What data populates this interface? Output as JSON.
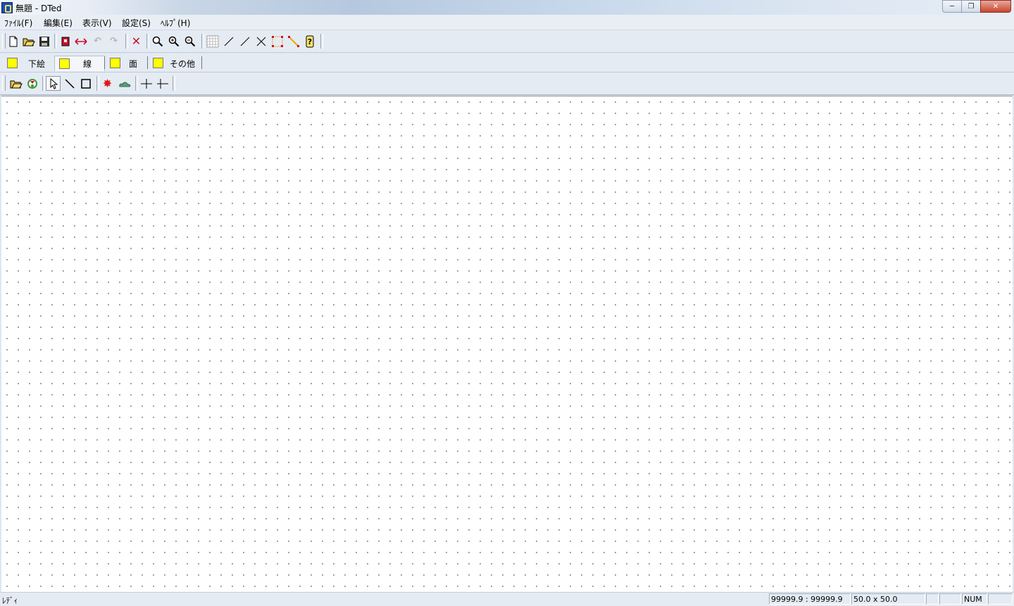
{
  "window": {
    "title": "無題 - DTed",
    "controls": [
      "minimize",
      "maximize",
      "close"
    ]
  },
  "menu": [
    "ﾌｧｲﾙ(F)",
    "編集(E)",
    "表示(V)",
    "設定(S)",
    "ﾍﾙﾌﾟ(H)"
  ],
  "toolbar": {
    "buttons": [
      "new-file-icon",
      "open-folder-icon",
      "save-disk-icon",
      "bring-layer-icon",
      "stretch-arrows-icon",
      "undo-icon",
      "redo-icon",
      "delete-x-icon",
      "zoom-icon",
      "zoom-in-icon",
      "zoom-out-icon",
      "grid-icon",
      "line-icon",
      "slash-line-icon",
      "cross-icon",
      "selection-box-icon",
      "yellow-line-icon",
      "help-icon"
    ]
  },
  "tabs": [
    {
      "label": "下絵",
      "color": "#ffff00"
    },
    {
      "label": "線",
      "color": "#ffff00",
      "active": true
    },
    {
      "label": "面",
      "color": "#ffff00"
    },
    {
      "label": "その他",
      "color": "#ffff00"
    }
  ],
  "toolbar2": {
    "buttons": [
      "open-image-icon",
      "refresh-icon",
      "pointer-icon",
      "draw-line-icon",
      "draw-rect-icon",
      "sun-icon",
      "cloud-icon",
      "horizontal-split-icon",
      "vertical-split-icon"
    ]
  },
  "status": {
    "ready": "ﾚﾃﾞｨ",
    "coords": "99999.9 : 99999.9",
    "size": "50.0 x 50.0",
    "num": "NUM"
  }
}
